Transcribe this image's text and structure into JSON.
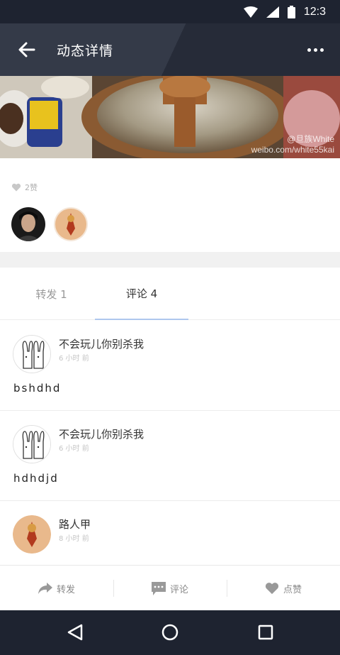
{
  "status_bar": {
    "time": "12:3",
    "icons": [
      "wifi-icon",
      "signal-icon",
      "battery-icon"
    ]
  },
  "header": {
    "title": "动态详情",
    "back_icon": "back-arrow-icon",
    "more_icon": "more-dots-icon"
  },
  "photo": {
    "watermark": "@旦族White\nweibo.com/white55kai"
  },
  "likes": {
    "count_label": "2赞"
  },
  "tabs": [
    {
      "label": "转发 1",
      "active": false
    },
    {
      "label": "评论 4",
      "active": true
    }
  ],
  "comments": [
    {
      "name": "不会玩儿你别杀我",
      "time": "6 小时 前",
      "body": "bshdhd"
    },
    {
      "name": "不会玩儿你别杀我",
      "time": "6 小时 前",
      "body": "hdhdjd"
    },
    {
      "name": "路人甲",
      "time": "8 小时 前",
      "body": ""
    }
  ],
  "actions": [
    {
      "label": "转发",
      "icon": "share-arrow-icon"
    },
    {
      "label": "评论",
      "icon": "comment-bubble-icon"
    },
    {
      "label": "点赞",
      "icon": "heart-icon"
    }
  ],
  "colors": {
    "status_bar": "#1e2330",
    "header": "#343a48",
    "tab_indicator": "#aec7ee"
  }
}
